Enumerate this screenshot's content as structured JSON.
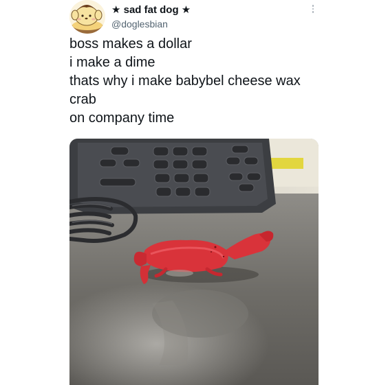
{
  "author": {
    "display_name": "★ sad fat dog ★",
    "handle": "@doglesbian",
    "avatar_icon": "pompompurin-avatar-icon"
  },
  "tweet": {
    "lines": [
      "boss makes a dollar",
      "i make a dime",
      "thats why i make babybel cheese wax",
      "crab",
      "on company time"
    ]
  },
  "menu_icon": "more-vertical-icon",
  "media": {
    "subject": "red-wax-crab-photo"
  }
}
